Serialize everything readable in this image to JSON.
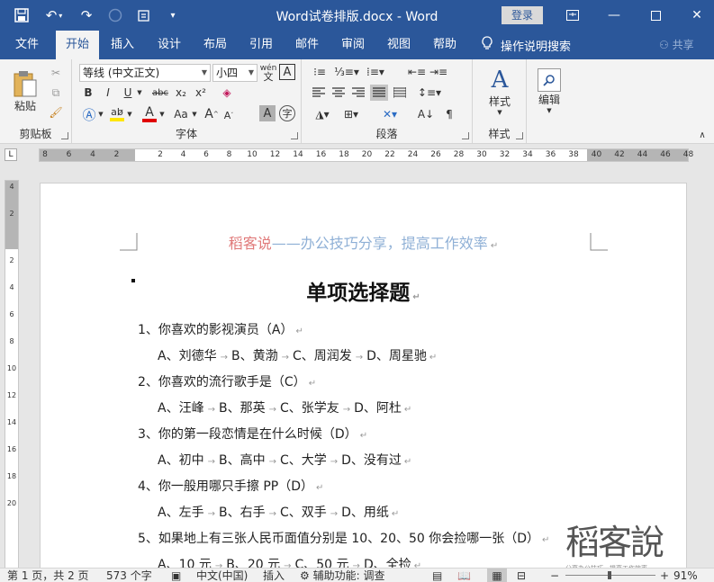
{
  "titlebar": {
    "title": "Word试卷排版.docx - Word",
    "login": "登录",
    "icons": [
      "save-icon",
      "undo-icon",
      "redo-icon",
      "circle-icon",
      "template-icon",
      "customize-qat-icon"
    ]
  },
  "tabs": [
    "文件",
    "开始",
    "插入",
    "设计",
    "布局",
    "引用",
    "邮件",
    "审阅",
    "视图",
    "帮助"
  ],
  "tell_me": "操作说明搜索",
  "share": "共享",
  "ribbon": {
    "clipboard": {
      "paste": "粘贴",
      "label": "剪贴板"
    },
    "font": {
      "name": "等线 (中文正文)",
      "size": "小四",
      "label": "字体",
      "pinyin": "wén",
      "format_chars": [
        "B",
        "I",
        "U",
        "abc",
        "x₂",
        "x²"
      ],
      "text_styles": [
        "A",
        "A",
        "Aa"
      ]
    },
    "paragraph": {
      "label": "段落"
    },
    "styles": {
      "button": "样式",
      "label": "样式"
    },
    "editing": {
      "button": "编辑"
    }
  },
  "ruler": {
    "corner": "L",
    "h_ticks": [
      "8",
      "6",
      "4",
      "2",
      "2",
      "4",
      "6",
      "8",
      "10",
      "12",
      "14",
      "16",
      "18",
      "20",
      "22",
      "24",
      "26",
      "28",
      "30",
      "32",
      "34",
      "36",
      "38",
      "40",
      "42",
      "44",
      "46",
      "48"
    ],
    "v_ticks": [
      "4",
      "2",
      "2",
      "4",
      "6",
      "8",
      "10",
      "12",
      "14",
      "16",
      "18",
      "20"
    ]
  },
  "document": {
    "header": {
      "brand": "稻客说",
      "rest": "——办公技巧分享，提高工作效率"
    },
    "heading": "单项选择题",
    "questions": [
      {
        "q": "1、你喜欢的影视演员（A）",
        "opts": [
          "A、刘德华",
          "B、黄渤",
          "C、周润发",
          "D、周星驰"
        ]
      },
      {
        "q": "2、你喜欢的流行歌手是（C）",
        "opts": [
          "A、汪峰",
          "B、那英",
          "C、张学友",
          "D、阿杜"
        ]
      },
      {
        "q": "3、你的第一段恋情是在什么时候（D）",
        "opts": [
          "A、初中",
          "B、高中",
          "C、大学",
          "D、没有过"
        ]
      },
      {
        "q": "4、你一般用哪只手擦 PP（D）",
        "opts": [
          "A、左手",
          "B、右手",
          "C、双手",
          "D、用纸"
        ]
      },
      {
        "q": "5、如果地上有三张人民币面值分别是 10、20、50 你会捡哪一张（D）",
        "opts": [
          "A、10 元",
          "B、20 元",
          "C、50 元",
          "D、全捡"
        ]
      }
    ],
    "watermark": {
      "main": "稻客說",
      "sub": "分享办公技巧  提高工作效率"
    }
  },
  "statusbar": {
    "page": "第 1 页，共 2 页",
    "words": "573 个字",
    "lang": "中文(中国)",
    "mode": "插入",
    "accessibility": "辅助功能: 调查",
    "zoom": "91%",
    "zoom_minus": "−",
    "zoom_plus": "+"
  }
}
